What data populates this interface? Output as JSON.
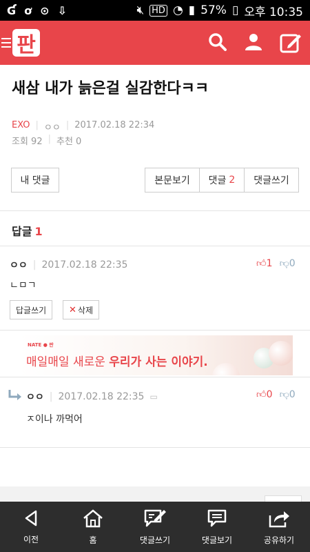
{
  "status_bar": {
    "battery": "57%",
    "time": "오후 10:35",
    "hd_label": "HD"
  },
  "app_bar": {
    "logo_text": "판",
    "brand_color": "#e8454a"
  },
  "post": {
    "title": "새삼 내가 늙은걸 실감한다ㅋㅋ",
    "category": "EXO",
    "author": "ㅇㅇ",
    "date": "2017.02.18 22:34",
    "views_label": "조회 92",
    "recommend_label": "추천 0"
  },
  "buttons": {
    "my_comments": "내 댓글",
    "view_post": "본문보기",
    "comments_label": "댓글",
    "comments_count": "2",
    "write_comment": "댓글쓰기"
  },
  "replies": {
    "title": "답글",
    "count": "1"
  },
  "comments": [
    {
      "author": "ㅇㅇ",
      "date": "2017.02.18 22:35",
      "body": "ㄴㅁㄱ",
      "up": "1",
      "down": "0",
      "reply_button": "답글쓰기",
      "delete_button": "삭제"
    },
    {
      "author": "ㅇㅇ",
      "date": "2017.02.18 22:35",
      "body": "ㅈ이나 까먹어",
      "up": "0",
      "down": "0"
    }
  ],
  "ad": {
    "brand": "NATE ● 판",
    "tagline_plain": "매일매일 새로운 ",
    "tagline_bold": "우리가 사는 이야기."
  },
  "bottom_nav": [
    {
      "label": "이전",
      "icon": "back-icon"
    },
    {
      "label": "홈",
      "icon": "home-icon"
    },
    {
      "label": "댓글쓰기",
      "icon": "write-comment-icon"
    },
    {
      "label": "댓글보기",
      "icon": "view-comments-icon"
    },
    {
      "label": "공유하기",
      "icon": "share-icon"
    }
  ]
}
